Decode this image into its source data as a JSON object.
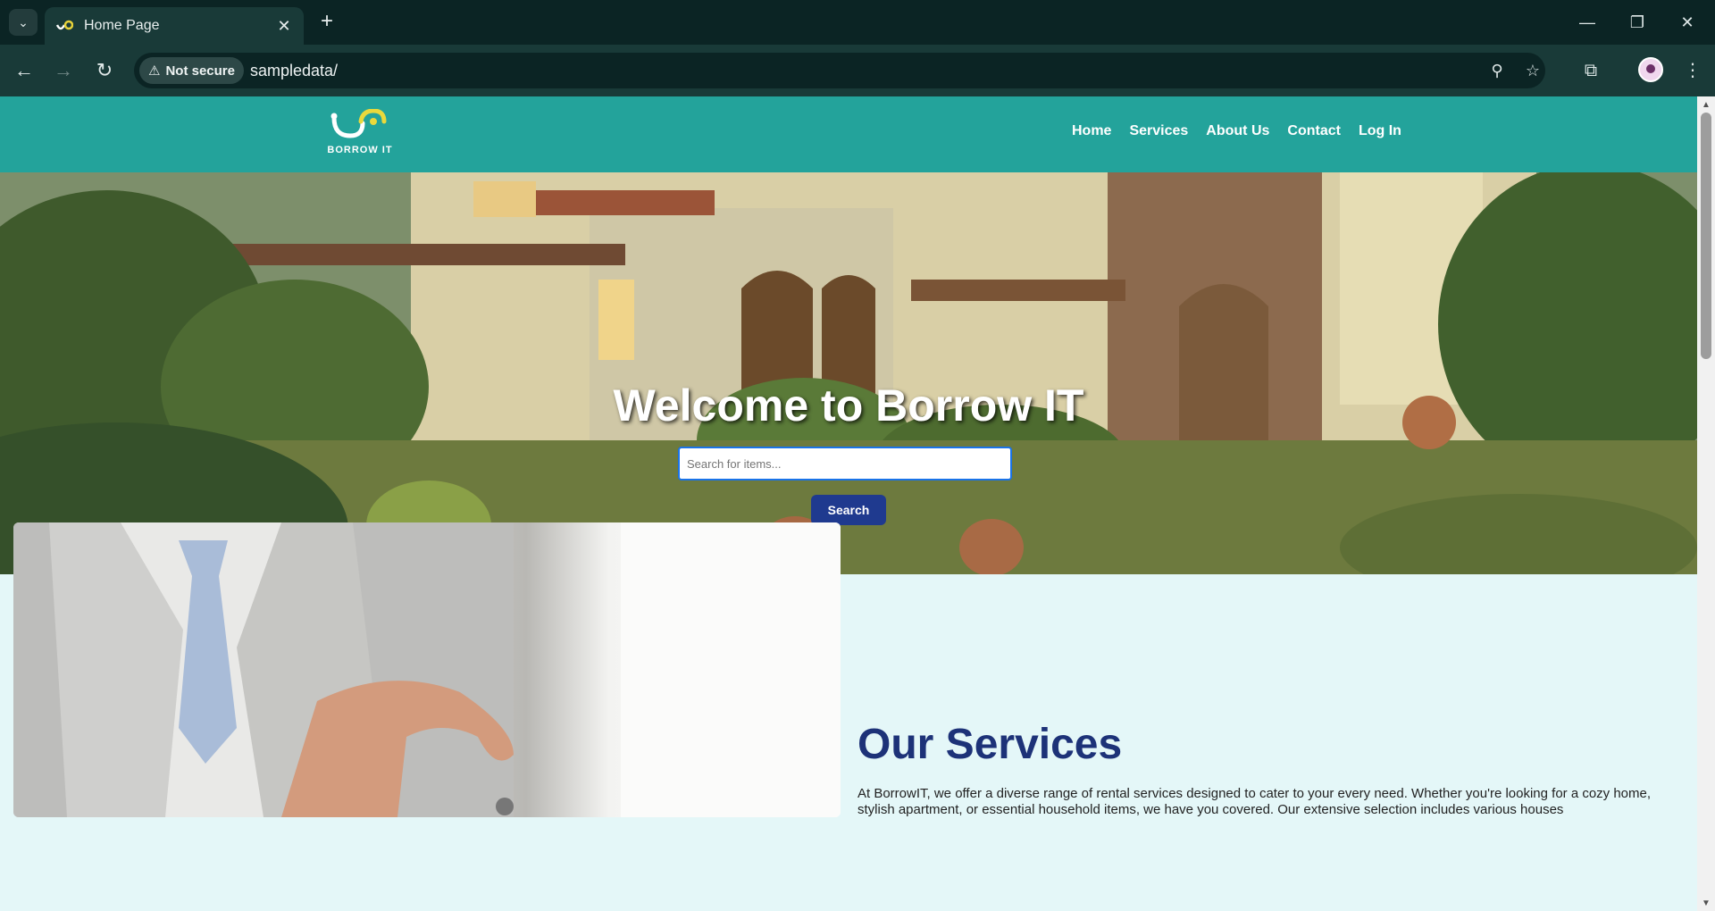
{
  "browser": {
    "tab_title": "Home Page",
    "security_label": "Not secure",
    "url": "sampledata/"
  },
  "site": {
    "logo_text": "BORROW IT",
    "nav": [
      "Home",
      "Services",
      "About Us",
      "Contact",
      "Log In"
    ]
  },
  "hero": {
    "title": "Welcome to Borrow IT",
    "search_placeholder": "Search for items...",
    "search_button": "Search"
  },
  "services": {
    "title": "Our Services",
    "description": "At BorrowIT, we offer a diverse range of rental services designed to cater to your every need. Whether you're looking for a cozy home, stylish apartment, or essential household items, we have you covered. Our extensive selection includes various houses"
  },
  "colors": {
    "header": "#23a39b",
    "accent_button": "#1f3a8f",
    "services_title": "#1d3278",
    "page_background": "#e4f7f8"
  }
}
